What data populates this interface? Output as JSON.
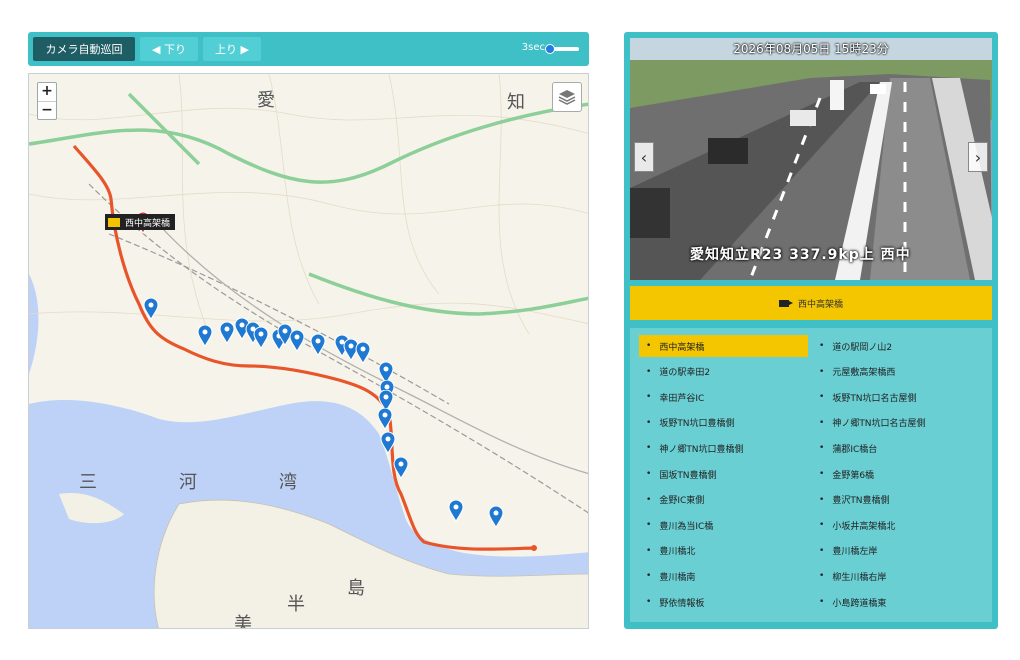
{
  "toolbar": {
    "auto_label": "カメラ自動巡回",
    "down_label": "◀ 下り",
    "up_label": "上り ▶",
    "speed_label": "3sec",
    "speed_fraction": 0.0
  },
  "map": {
    "zoom_in": "+",
    "zoom_out": "−",
    "selected_camera_label": "西中高架橋",
    "place_names": [
      "愛",
      "知",
      "三",
      "河",
      "湾",
      "半",
      "島",
      "美"
    ],
    "colors": {
      "route": "#e8552a",
      "pin": "#1f78d1",
      "selected_pin": "#d2352f"
    }
  },
  "camera": {
    "timestamp": "2026年08月05日 15時23分",
    "caption": "愛知知立R23 337.9kp上 西中",
    "prev_icon": "chevron-left-icon",
    "next_icon": "chevron-right-icon",
    "title": "西中高架橋"
  },
  "camera_list": {
    "left": [
      "西中高架橋",
      "道の駅幸田2",
      "幸田芦谷IC",
      "坂野TN坑口豊橋側",
      "神ノ郷TN坑口豊橋側",
      "国坂TN豊橋側",
      "金野IC東側",
      "豊川為当IC橋",
      "豊川橋北",
      "豊川橋南",
      "野依情報板"
    ],
    "right": [
      "道の駅岡ノ山2",
      "元屋敷高架橋西",
      "坂野TN坑口名古屋側",
      "神ノ郷TN坑口名古屋側",
      "蒲郡IC橋台",
      "金野第6橋",
      "豊沢TN豊橋側",
      "小坂井高架橋北",
      "豊川橋左岸",
      "柳生川橋右岸",
      "小島跨道橋東"
    ],
    "active": "西中高架橋"
  }
}
